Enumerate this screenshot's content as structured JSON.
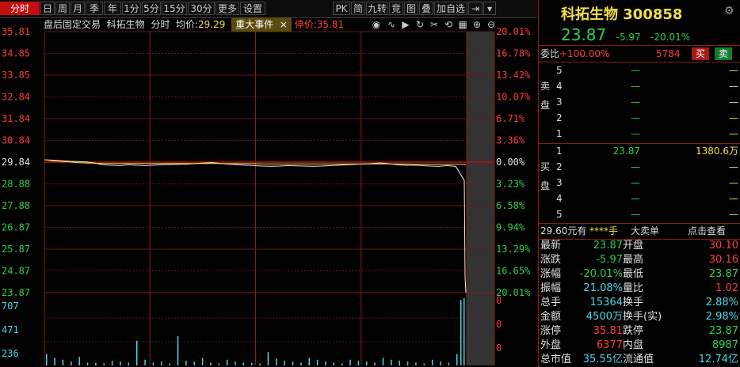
{
  "toolbar": {
    "tabs": [
      "分时",
      "日",
      "周",
      "月",
      "季",
      "年",
      "1分",
      "5分",
      "15分",
      "30分",
      "更多",
      "设置"
    ],
    "right_tabs": [
      "PK",
      "简",
      "九转",
      "竞",
      "图",
      "叠",
      "加自选"
    ]
  },
  "chart": {
    "info_mode": "盘后固定交易",
    "info_name": "科拓生物",
    "info_kind": "分时",
    "info_avg_label": "均价:",
    "info_avg_value": "29.29",
    "event_label": "重大事件",
    "close_x": "×",
    "limit_text": "停价:35.81",
    "left_axis": [
      "35.81",
      "34.85",
      "33.85",
      "32.84",
      "31.84",
      "30.84",
      "29.84",
      "28.88",
      "27.88",
      "26.87",
      "25.87",
      "24.87",
      "23.87"
    ],
    "right_axis": [
      "20.01%",
      "16.78%",
      "13.42%",
      "10.07%",
      "6.71%",
      "3.36%",
      "0.00%",
      "3.23%",
      "6.58%",
      "9.94%",
      "13.29%",
      "16.65%",
      "20.01%"
    ],
    "vol_left": [
      "707",
      "471",
      "236"
    ],
    "vol_right": [
      "0",
      "0",
      "0",
      "0"
    ]
  },
  "chart_data": {
    "type": "line",
    "title": "",
    "prev_close": 29.84,
    "ylim": [
      23.87,
      35.81
    ],
    "series": [
      {
        "values": [
          29.95,
          29.93,
          29.9,
          29.88,
          29.87,
          29.85,
          29.8,
          29.72,
          29.7,
          29.68,
          29.72,
          29.7,
          29.68,
          29.7,
          29.72,
          29.73,
          29.74,
          29.75,
          29.78,
          29.8,
          29.82,
          29.78,
          29.75,
          29.72,
          29.7,
          29.68,
          29.66,
          29.65,
          29.66,
          29.68,
          29.67,
          29.66,
          29.65,
          29.66,
          29.68,
          29.7,
          29.72,
          29.74,
          29.76,
          29.78,
          29.8,
          29.77,
          29.72,
          29.7,
          29.7,
          29.68,
          29.66,
          29.65,
          29.68,
          29.64,
          29.0,
          24.6,
          23.87
        ]
      },
      {
        "values": [
          29.95,
          29.9,
          29.88,
          29.85,
          29.82,
          29.8,
          29.79,
          29.78,
          29.78,
          29.78,
          29.78,
          29.78,
          29.78,
          29.78,
          29.78,
          29.78,
          29.78,
          29.78,
          29.78,
          29.78,
          29.78,
          29.78,
          29.77,
          29.77,
          29.77,
          29.77,
          29.76,
          29.76,
          29.76,
          29.76,
          29.76,
          29.76,
          29.76,
          29.76,
          29.76,
          29.76,
          29.76,
          29.76,
          29.76,
          29.76,
          29.76,
          29.76,
          29.76,
          29.76,
          29.75,
          29.75,
          29.75,
          29.75,
          29.75,
          29.75,
          29.75,
          29.72,
          29.7
        ]
      }
    ],
    "volume": [
      120,
      80,
      60,
      40,
      90,
      30,
      25,
      20,
      50,
      40,
      30,
      260,
      60,
      30,
      40,
      20,
      310,
      50,
      40,
      80,
      30,
      20,
      60,
      40,
      30,
      25,
      20,
      140,
      70,
      50,
      40,
      30,
      80,
      60,
      40,
      30,
      20,
      60,
      50,
      40,
      30,
      80,
      60,
      50,
      40,
      30,
      20,
      60,
      40,
      30,
      120,
      690,
      710
    ]
  },
  "panel": {
    "name_code": "科拓生物 300858",
    "price": "23.87",
    "change": "-5.97",
    "change_pct": "-20.01%",
    "weibi_label": "委比",
    "weibi_value": "+100.00%",
    "weibi_num": "5784",
    "sell_btn": "买",
    "buy_btn": "卖",
    "sell_side_label": "卖盘",
    "buy_side_label": "买盘",
    "sell_rows": [
      {
        "n": "5",
        "p": "—",
        "v": "—"
      },
      {
        "n": "4",
        "p": "—",
        "v": "—"
      },
      {
        "n": "3",
        "p": "—",
        "v": "—"
      },
      {
        "n": "2",
        "p": "—",
        "v": "—"
      },
      {
        "n": "1",
        "p": "—",
        "v": "—"
      }
    ],
    "buy_rows": [
      {
        "n": "1",
        "p": "23.87",
        "v": "1380.6万"
      },
      {
        "n": "2",
        "p": "—",
        "v": "—"
      },
      {
        "n": "3",
        "p": "—",
        "v": "—"
      },
      {
        "n": "4",
        "p": "—",
        "v": "—"
      },
      {
        "n": "5",
        "p": "—",
        "v": "—"
      }
    ],
    "big_order": "29.60元有",
    "big_order_mask": "****手",
    "big_order_label": "大卖单",
    "big_order_link": "点击查看",
    "stats": [
      {
        "l1": "最新",
        "v1": "23.87",
        "l2": "开盘",
        "v2": "30.10"
      },
      {
        "l1": "涨跌",
        "v1": "-5.97",
        "l2": "最高",
        "v2": "30.16"
      },
      {
        "l1": "涨幅",
        "v1": "-20.01%",
        "l2": "最低",
        "v2": "23.87"
      },
      {
        "l1": "振幅",
        "v1": "21.08%",
        "l2": "量比",
        "v2": "1.02"
      },
      {
        "l1": "总手",
        "v1": "15364",
        "l2": "换手",
        "v2": "2.88%"
      },
      {
        "l1": "金额",
        "v1": "4500万",
        "l2": "换手(实)",
        "v2": "2.98%"
      },
      {
        "l1": "涨停",
        "v1": "35.81",
        "l2": "跌停",
        "v2": "23.87"
      },
      {
        "l1": "外盘",
        "v1": "6377",
        "l2": "内盘",
        "v2": "8987"
      },
      {
        "l1": "总市值",
        "v1": "35.55亿",
        "l2": "流通值",
        "v2": "12.74亿"
      }
    ]
  }
}
